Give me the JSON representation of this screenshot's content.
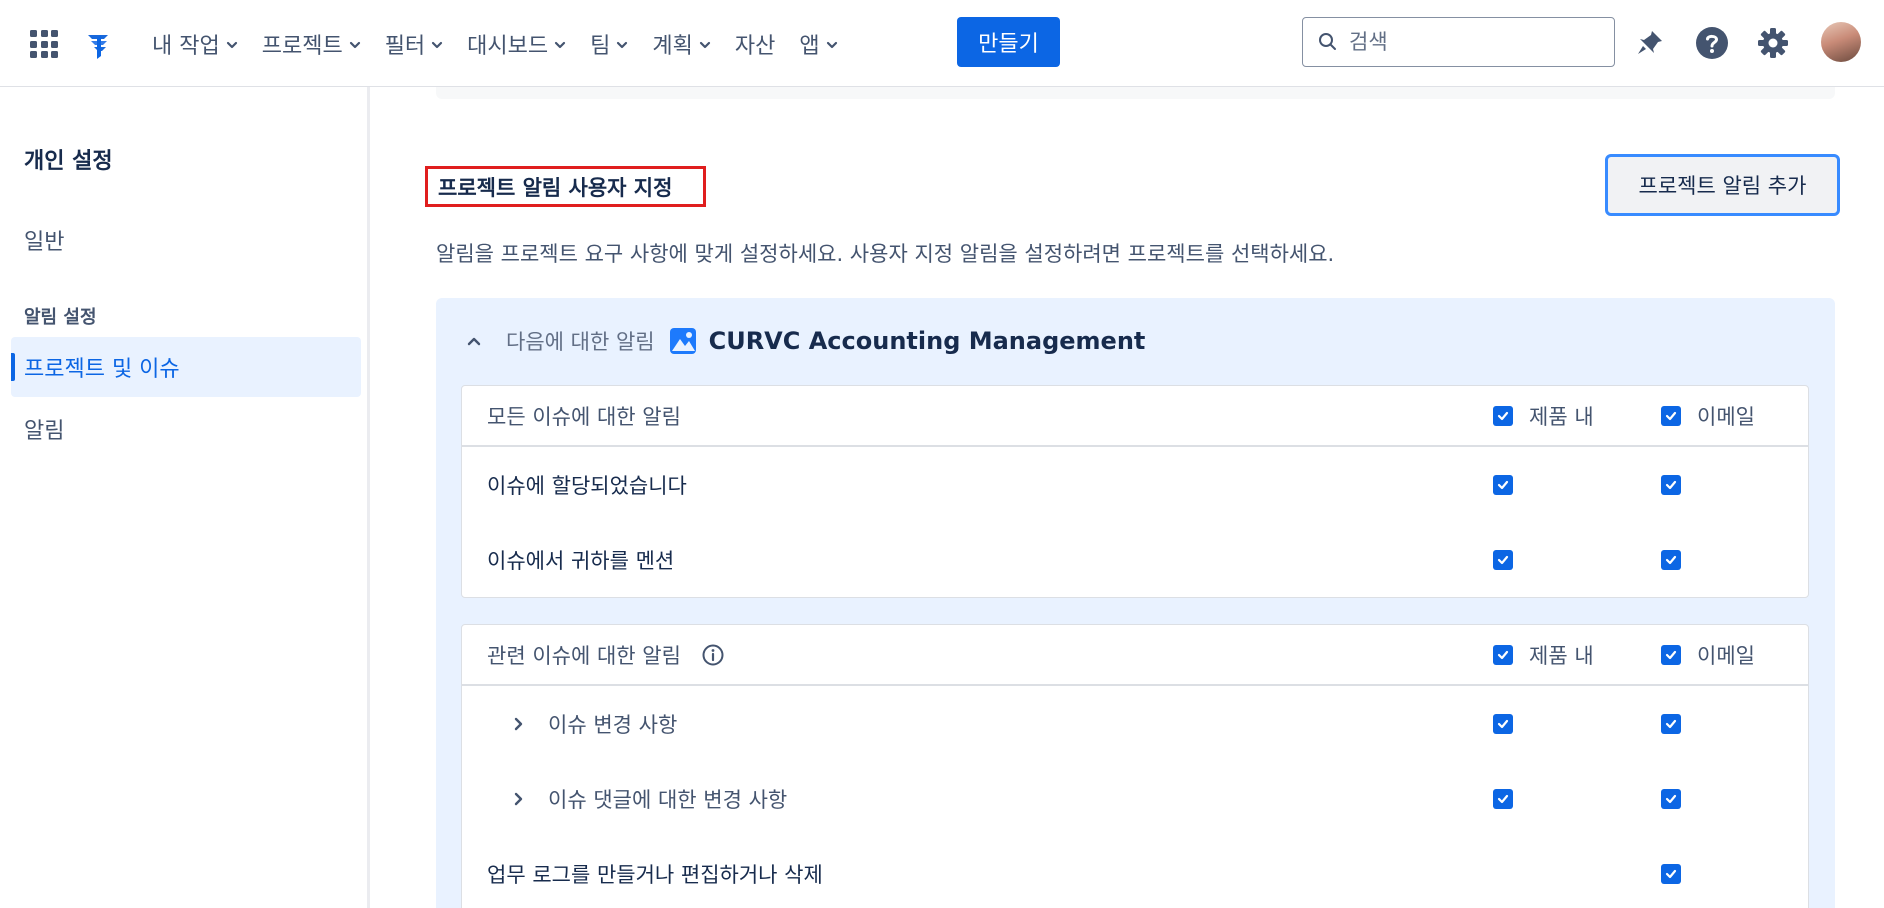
{
  "nav": {
    "items": [
      {
        "label": "내 작업",
        "dropdown": true
      },
      {
        "label": "프로젝트",
        "dropdown": true
      },
      {
        "label": "필터",
        "dropdown": true
      },
      {
        "label": "대시보드",
        "dropdown": true
      },
      {
        "label": "팀",
        "dropdown": true
      },
      {
        "label": "계획",
        "dropdown": true
      },
      {
        "label": "자산",
        "dropdown": false
      },
      {
        "label": "앱",
        "dropdown": true
      }
    ],
    "create_label": "만들기",
    "search_placeholder": "검색",
    "icons": [
      "apps-grid-icon",
      "jira-logo-icon",
      "search-icon",
      "notifications-icon",
      "help-icon",
      "settings-icon"
    ],
    "accent_color": "#0c66e4"
  },
  "sidebar": {
    "title": "개인 설정",
    "general": "일반",
    "section": "알림 설정",
    "items": [
      {
        "label": "프로젝트 및 이슈",
        "active": true
      },
      {
        "label": "알림",
        "active": false
      }
    ]
  },
  "main": {
    "section_title": "프로젝트 알림 사용자 지정",
    "add_button": "프로젝트 알림 추가",
    "description": "알림을 프로젝트 요구 사항에 맞게 설정하세요. 사용자 지정 알림을 설정하려면 프로젝트를 선택하세요.",
    "project": {
      "for_label": "다음에 대한 알림",
      "name": "CURVC Accounting Management",
      "expanded": true
    },
    "columns": {
      "in_product": "제품 내",
      "email": "이메일"
    },
    "groups": [
      {
        "title": "모든 이슈에 대한 알림",
        "has_info": false,
        "header_in_product": true,
        "header_email": true,
        "rows": [
          {
            "label": "이슈에 할당되었습니다",
            "in_product": true,
            "email": true,
            "expandable": false
          },
          {
            "label": "이슈에서 귀하를 멘션",
            "in_product": true,
            "email": true,
            "expandable": false
          }
        ]
      },
      {
        "title": "관련 이슈에 대한 알림",
        "has_info": true,
        "header_in_product": true,
        "header_email": true,
        "rows": [
          {
            "label": "이슈 변경 사항",
            "in_product": true,
            "email": true,
            "expandable": true
          },
          {
            "label": "이슈 댓글에 대한 변경 사항",
            "in_product": true,
            "email": true,
            "expandable": true
          },
          {
            "label": "업무 로그를 만들거나 편집하거나 삭제",
            "in_product": false,
            "email": true,
            "expandable": false
          }
        ]
      }
    ]
  }
}
